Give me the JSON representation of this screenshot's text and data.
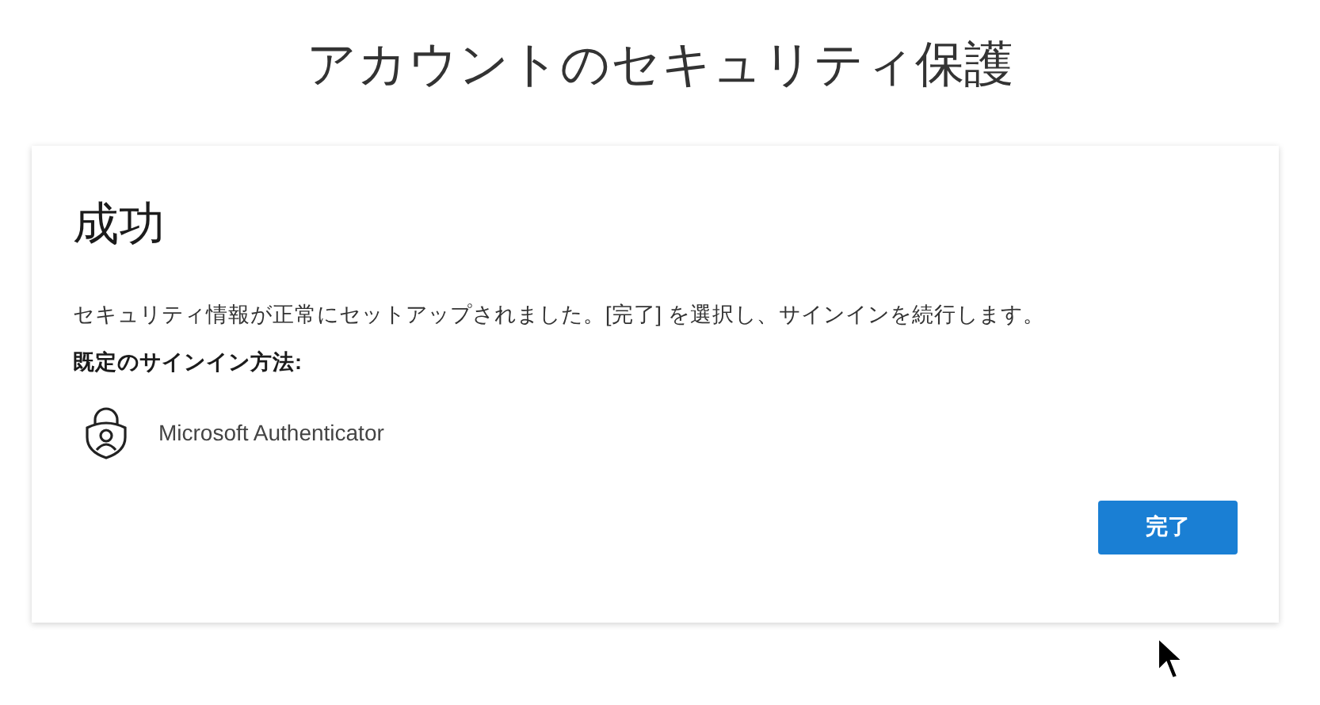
{
  "page_title": "アカウントのセキュリティ保護",
  "card": {
    "heading": "成功",
    "message": "セキュリティ情報が正常にセットアップされました。[完了] を選択し、サインインを続行します。",
    "default_method_label": "既定のサインイン方法:",
    "method": {
      "name": "Microsoft Authenticator"
    },
    "button": "完了"
  }
}
